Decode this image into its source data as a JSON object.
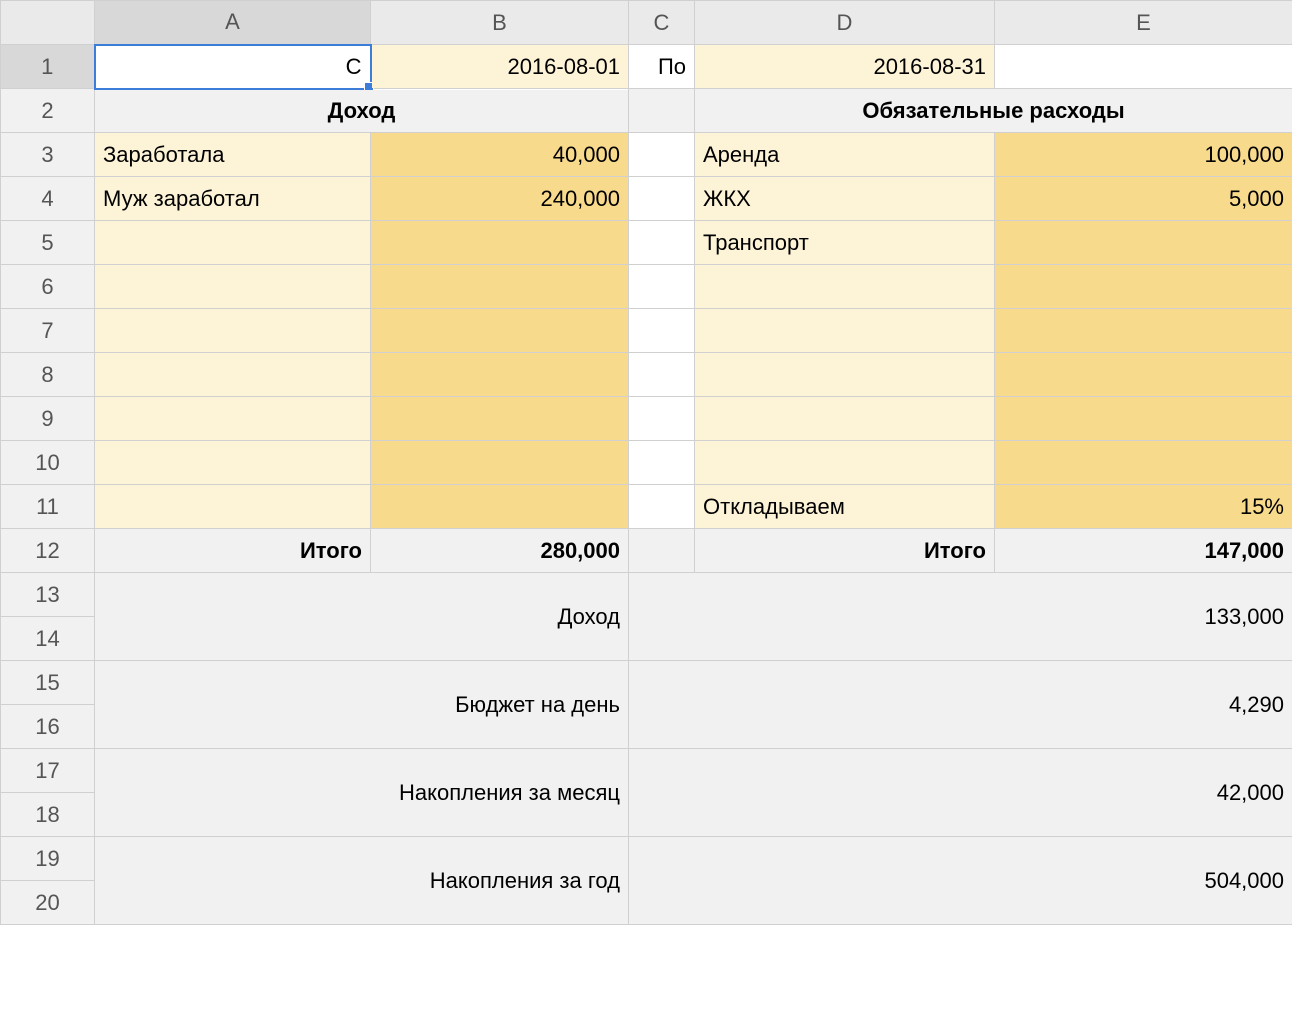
{
  "columns": [
    "A",
    "B",
    "C",
    "D",
    "E"
  ],
  "rows": [
    "1",
    "2",
    "3",
    "4",
    "5",
    "6",
    "7",
    "8",
    "9",
    "10",
    "11",
    "12",
    "13",
    "14",
    "15",
    "16",
    "17",
    "18",
    "19",
    "20"
  ],
  "r1": {
    "A": "С",
    "B": "2016-08-01",
    "C": "По",
    "D": "2016-08-31"
  },
  "r2": {
    "AB": "Доход",
    "DE": "Обязательные расходы"
  },
  "income": {
    "items": [
      {
        "label": "Заработала",
        "value": "40,000"
      },
      {
        "label": "Муж заработал",
        "value": "240,000"
      }
    ],
    "total_label": "Итого",
    "total_value": "280,000"
  },
  "expenses": {
    "items": [
      {
        "label": "Аренда",
        "value": "100,000"
      },
      {
        "label": "ЖКХ",
        "value": "5,000"
      },
      {
        "label": "Транспорт",
        "value": ""
      }
    ],
    "save_label": "Откладываем",
    "save_value": "15%",
    "total_label": "Итого",
    "total_value": "147,000"
  },
  "summary": [
    {
      "label": "Доход",
      "value": "133,000"
    },
    {
      "label": "Бюджет на день",
      "value": "4,290"
    },
    {
      "label": "Накопления за месяц",
      "value": "42,000"
    },
    {
      "label": "Накопления за год",
      "value": "504,000"
    }
  ]
}
